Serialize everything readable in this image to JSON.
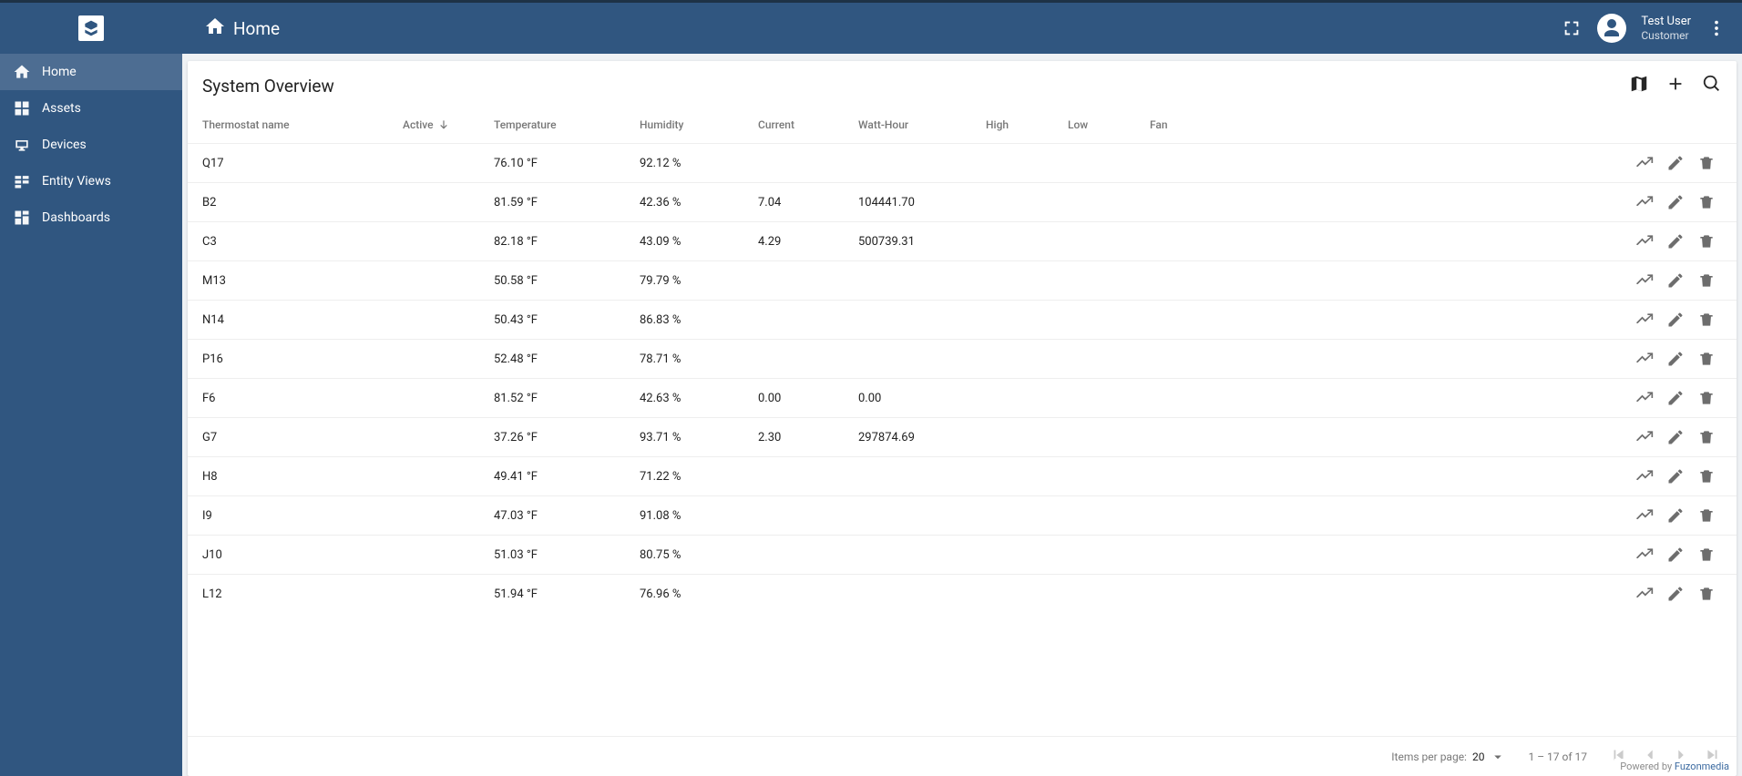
{
  "header": {
    "title": "Home"
  },
  "user": {
    "name": "Test User",
    "role": "Customer"
  },
  "nav": [
    {
      "label": "Home",
      "icon": "home"
    },
    {
      "label": "Assets",
      "icon": "grid"
    },
    {
      "label": "Devices",
      "icon": "devices"
    },
    {
      "label": "Entity Views",
      "icon": "entity"
    },
    {
      "label": "Dashboards",
      "icon": "dash"
    }
  ],
  "activeNav": 0,
  "card": {
    "title": "System Overview"
  },
  "columns": {
    "name": "Thermostat name",
    "active": "Active",
    "temperature": "Temperature",
    "humidity": "Humidity",
    "current": "Current",
    "watthour": "Watt-Hour",
    "high": "High",
    "low": "Low",
    "fan": "Fan"
  },
  "rows": [
    {
      "name": "Q17",
      "active": "green",
      "temperature": "76.10 °F",
      "humidity": "92.12 %",
      "current": "",
      "watthour": "",
      "high": "off",
      "low": "off",
      "fan": "red"
    },
    {
      "name": "B2",
      "active": "green",
      "temperature": "81.59 °F",
      "humidity": "42.36 %",
      "current": "7.04",
      "watthour": "104441.70",
      "high": "off",
      "low": "red",
      "fan": "green"
    },
    {
      "name": "C3",
      "active": "green",
      "temperature": "82.18 °F",
      "humidity": "43.09 %",
      "current": "4.29",
      "watthour": "500739.31",
      "high": "red",
      "low": "off",
      "fan": "green"
    },
    {
      "name": "M13",
      "active": "green",
      "temperature": "50.58 °F",
      "humidity": "79.79 %",
      "current": "",
      "watthour": "",
      "high": "off",
      "low": "off",
      "fan": "red"
    },
    {
      "name": "N14",
      "active": "green",
      "temperature": "50.43 °F",
      "humidity": "86.83 %",
      "current": "",
      "watthour": "",
      "high": "off",
      "low": "off",
      "fan": "red"
    },
    {
      "name": "P16",
      "active": "green",
      "temperature": "52.48 °F",
      "humidity": "78.71 %",
      "current": "",
      "watthour": "",
      "high": "off",
      "low": "off",
      "fan": "red"
    },
    {
      "name": "F6",
      "active": "green",
      "temperature": "81.52 °F",
      "humidity": "42.63 %",
      "current": "0.00",
      "watthour": "0.00",
      "high": "off",
      "low": "off",
      "fan": "red"
    },
    {
      "name": "G7",
      "active": "green",
      "temperature": "37.26 °F",
      "humidity": "93.71 %",
      "current": "2.30",
      "watthour": "297874.69",
      "high": "off",
      "low": "off",
      "fan": "green"
    },
    {
      "name": "H8",
      "active": "green",
      "temperature": "49.41 °F",
      "humidity": "71.22 %",
      "current": "",
      "watthour": "",
      "high": "off",
      "low": "off",
      "fan": "red"
    },
    {
      "name": "I9",
      "active": "green",
      "temperature": "47.03 °F",
      "humidity": "91.08 %",
      "current": "",
      "watthour": "",
      "high": "off",
      "low": "off",
      "fan": "red"
    },
    {
      "name": "J10",
      "active": "green",
      "temperature": "51.03 °F",
      "humidity": "80.75 %",
      "current": "",
      "watthour": "",
      "high": "off",
      "low": "off",
      "fan": "red"
    },
    {
      "name": "L12",
      "active": "green",
      "temperature": "51.94 °F",
      "humidity": "76.96 %",
      "current": "",
      "watthour": "",
      "high": "off",
      "low": "off",
      "fan": "red"
    }
  ],
  "paginator": {
    "itemsPerPageLabel": "Items per page:",
    "itemsPerPage": "20",
    "range": "1 – 17 of 17"
  },
  "footer": {
    "prefix": "Powered by ",
    "brand": "Fuzonmedia"
  }
}
